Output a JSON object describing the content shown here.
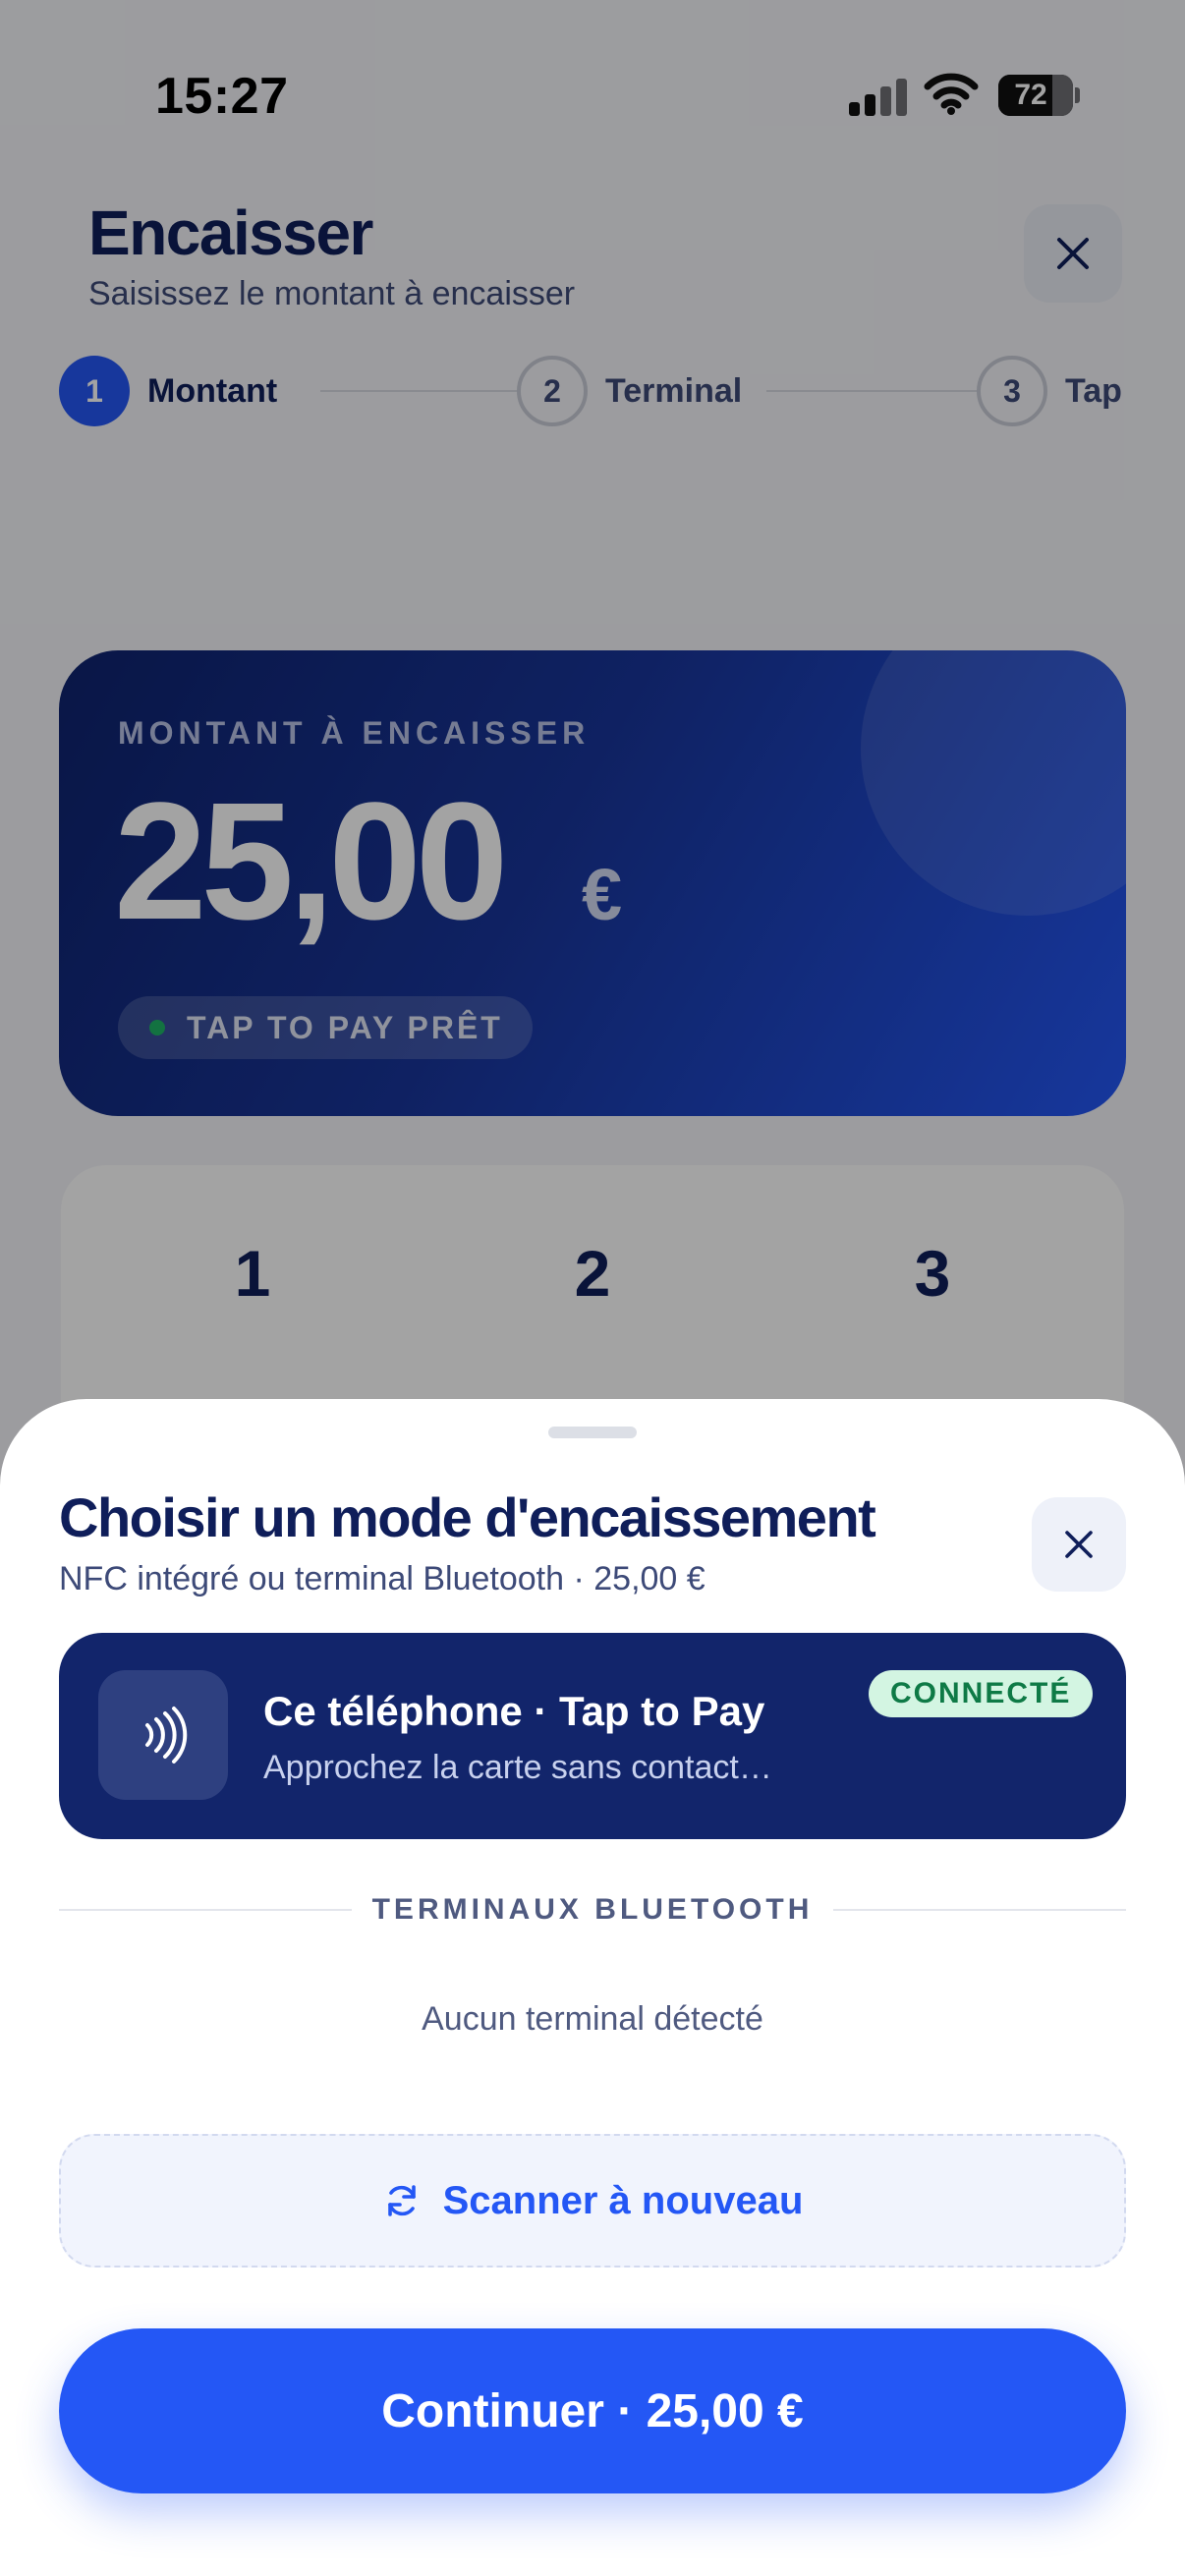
{
  "status_bar": {
    "time": "15:27",
    "battery": "72",
    "battery_level": 0.72
  },
  "header": {
    "title": "Encaisser",
    "subtitle": "Saisissez le montant à encaisser"
  },
  "stepper": {
    "steps": [
      {
        "number": "1",
        "label": "Montant",
        "active": true
      },
      {
        "number": "2",
        "label": "Terminal",
        "active": false
      },
      {
        "number": "3",
        "label": "Tap",
        "active": false
      }
    ]
  },
  "amount_card": {
    "label": "MONTANT À ENCAISSER",
    "value": "25,00",
    "currency": "€",
    "status": "TAP TO PAY PRÊT"
  },
  "keypad": {
    "visible_keys": [
      "1",
      "2",
      "3"
    ]
  },
  "sheet": {
    "title": "Choisir un mode d'encaissement",
    "subtitle": "NFC intégré ou terminal Bluetooth · 25,00 €",
    "phone_option": {
      "title": "Ce téléphone · Tap to Pay",
      "subtitle": "Approchez la carte sans contact…",
      "badge": "CONNECTÉ"
    },
    "section_label": "TERMINAUX BLUETOOTH",
    "empty_message": "Aucun terminal détecté",
    "scan_label": "Scanner à nouveau",
    "continue_label": "Continuer · 25,00 €"
  },
  "colors": {
    "accent": "#2457f5",
    "navy": "#0f1e5a",
    "card_navy": "#12256b",
    "success": "#1fb266",
    "badge_bg": "#d3f5e2"
  }
}
